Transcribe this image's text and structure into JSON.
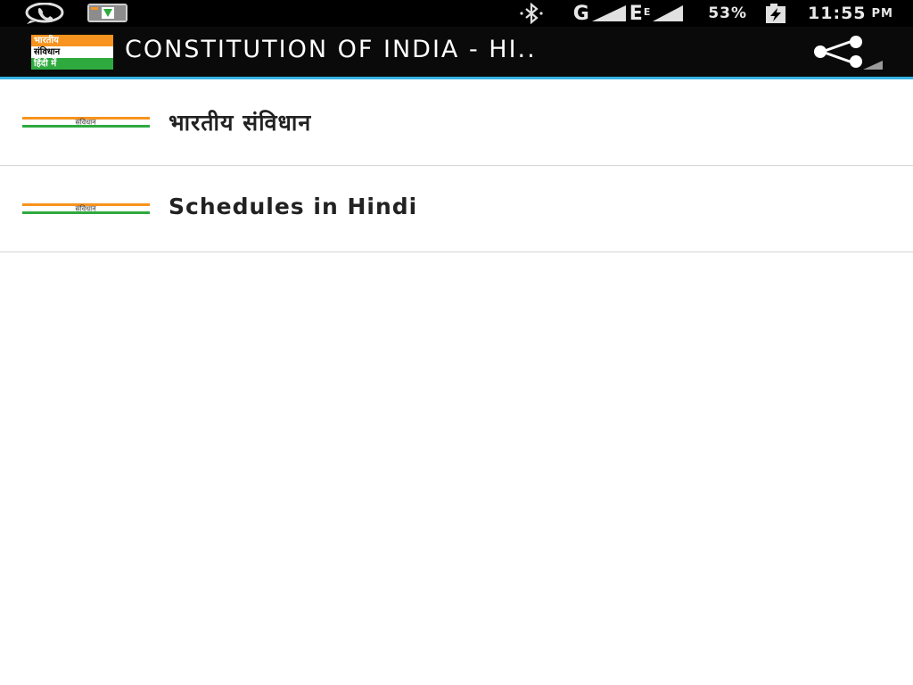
{
  "status_bar": {
    "left_icons": [
      "whatsapp-icon",
      "app-notification-icon"
    ],
    "network_label": "G",
    "edge_label": "E",
    "battery": "53%",
    "time": "11:55",
    "time_suffix": "PM"
  },
  "action_bar": {
    "logo": {
      "line1": "भारतीय",
      "line2": "संविधान",
      "line3": "हिंदी में"
    },
    "title": "CONSTITUTION OF INDIA - HI..",
    "share_icon": "share-icon"
  },
  "list": {
    "items": [
      {
        "label": "भारतीय संविधान",
        "flag_text": "संविधान"
      },
      {
        "label": "Schedules in Hindi",
        "flag_text": "संविधान"
      }
    ]
  },
  "colors": {
    "accent": "#33b5e5",
    "saffron": "#f7931e",
    "green": "#2eaa3f",
    "status_bar": "#000000"
  }
}
